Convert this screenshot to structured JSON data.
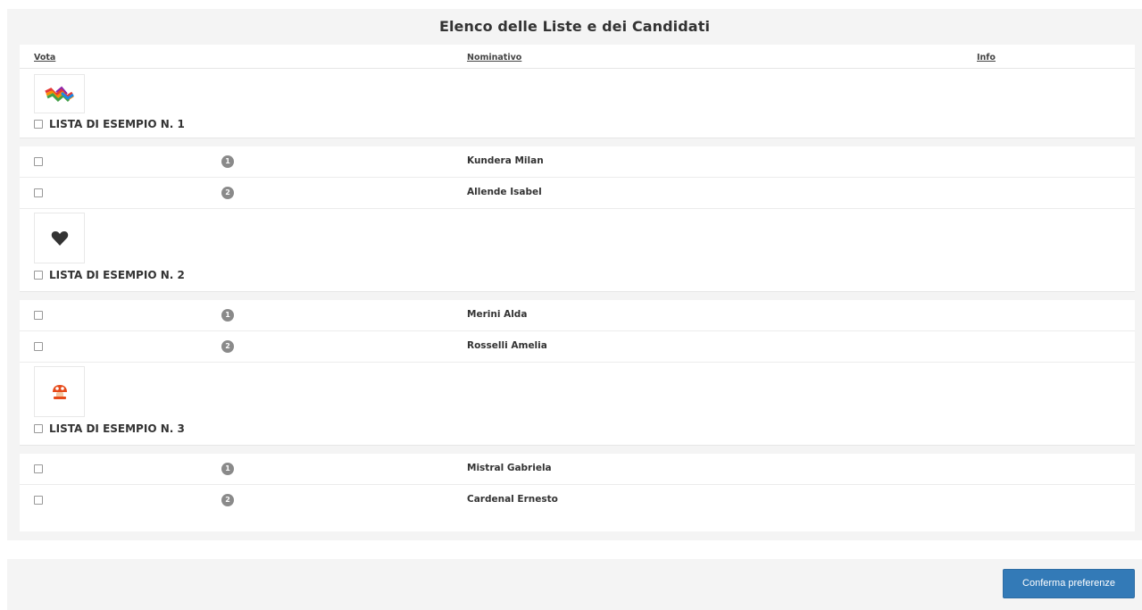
{
  "page": {
    "title": "Elenco delle Liste e dei Candidati"
  },
  "columns": {
    "vote": "Vota",
    "name": "Nominativo",
    "info": "Info"
  },
  "lists": [
    {
      "name": "LISTA DI ESEMPIO N. 1",
      "logo_icon": "rainbow-wave-icon",
      "candidates": [
        {
          "position": "1",
          "name": "Kundera Milan"
        },
        {
          "position": "2",
          "name": "Allende Isabel"
        }
      ]
    },
    {
      "name": "LISTA DI ESEMPIO N. 2",
      "logo_icon": "heart-icon",
      "candidates": [
        {
          "position": "1",
          "name": "Merini Alda"
        },
        {
          "position": "2",
          "name": "Rosselli Amelia"
        }
      ]
    },
    {
      "name": "LISTA DI ESEMPIO N. 3",
      "logo_icon": "mushroom-icon",
      "candidates": [
        {
          "position": "1",
          "name": "Mistral Gabriela"
        },
        {
          "position": "2",
          "name": "Cardenal Ernesto"
        }
      ]
    }
  ],
  "actions": {
    "confirm_label": "Conferma preferenze"
  },
  "colors": {
    "primary_button": "#337ab7",
    "badge": "#8a8a8a",
    "panel_bg": "#f4f4f4"
  }
}
